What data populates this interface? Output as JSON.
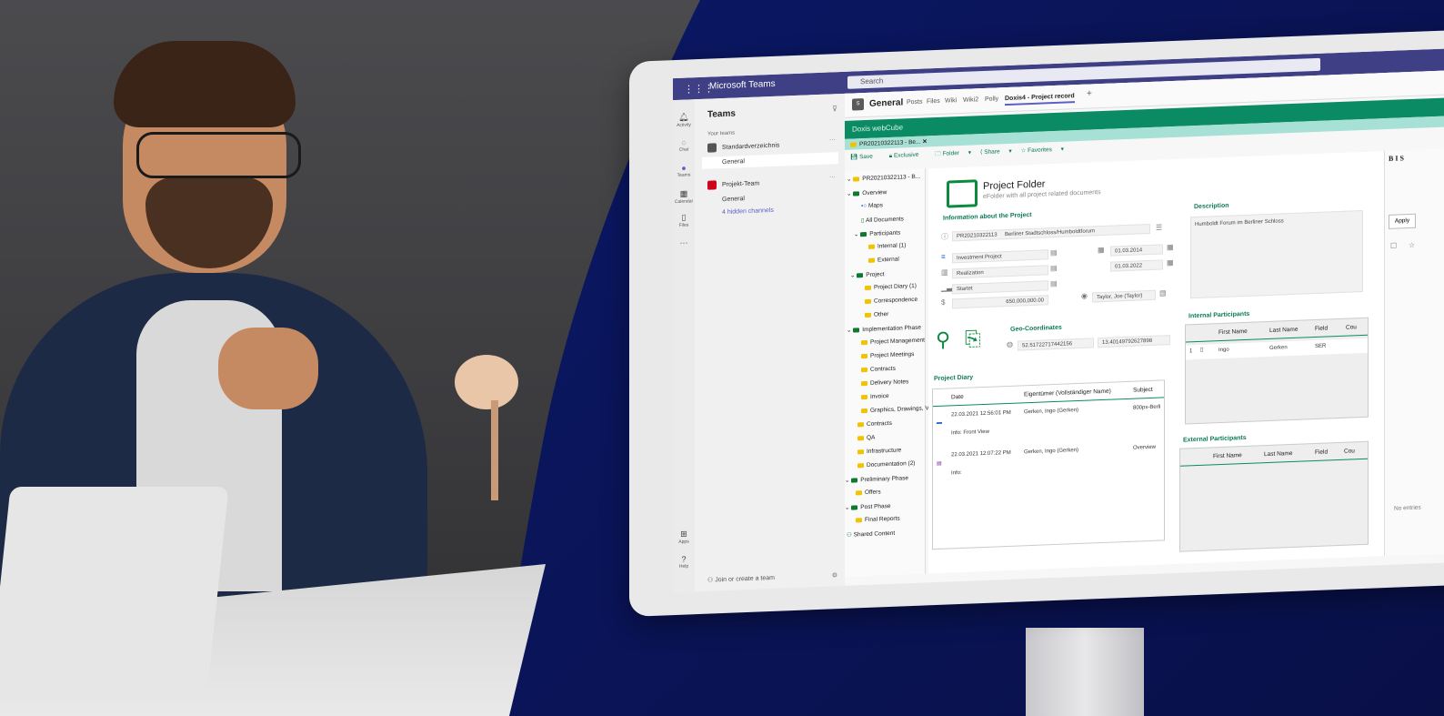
{
  "teams_app": {
    "title": "Microsoft Teams",
    "search_placeholder": "Search",
    "rail": [
      "Activity",
      "Chat",
      "Teams",
      "Calendar",
      "Files",
      "Apps",
      "Help"
    ],
    "teams_header": "Teams",
    "your_teams": "Your teams",
    "team1": "Standardverzeichnis",
    "team1_channel": "General",
    "team2": "Projekt-Team",
    "team2_channel": "General",
    "hidden_channels": "4 hidden channels",
    "join": "Join or create a team"
  },
  "channel": {
    "badge": "S",
    "title": "General",
    "tabs": [
      "Posts",
      "Files",
      "Wiki",
      "Wiki2",
      "Polly",
      "Doxis4 - Project record"
    ]
  },
  "webcube": {
    "brand": "Doxis webCube",
    "doc_tab": "PR20210322113 - Be...",
    "toolbar": [
      "Save",
      "Exclusive",
      "Folder",
      "Share",
      "Favorites"
    ]
  },
  "tree": [
    "PR20210322113 - B...",
    "Overview",
    "Maps",
    "All Documents",
    "Participants",
    "Internal (1)",
    "External",
    "Project",
    "Project Diary (1)",
    "Correspondence",
    "Other",
    "Implementation Phase",
    "Project Management",
    "Project Meetings",
    "Contracts",
    "Delivery Notes",
    "Invoice",
    "Graphics, Drawings, Vid",
    "Contracts",
    "QA",
    "Infrastructure",
    "Documentation (2)",
    "Preliminary Phase",
    "Offers",
    "Post Phase",
    "Final Reports",
    "Shared Content"
  ],
  "folder": {
    "title": "Project Folder",
    "subtitle": "eFolder with all project related documents",
    "info_header": "Information about the Project",
    "project_no": "PR20210322113",
    "project_name": "Berliner Stadtschloss/Humboldtforum",
    "type": "Investment Project",
    "phase": "Realization",
    "status": "Startet",
    "amount": "650,000,000.00",
    "date_start": "01.03.2014",
    "date_end": "01.03.2022",
    "owner": "Taylor, Joe (Taylor)",
    "geo_header": "Geo-Coordinates",
    "lat": "52.51722717442156",
    "lon": "13.40149792627898",
    "desc_header": "Description",
    "desc": "Humboldt Forum im Berliner Schloss"
  },
  "diary": {
    "header": "Project Diary",
    "cols": [
      "Date",
      "Eigentümer (Vollständiger Name)",
      "Subject"
    ],
    "rows": [
      {
        "date": "22.03.2021 12:56:01 PM",
        "owner": "Gerken, Ingo (Gerken)",
        "subject": "800px-Berli",
        "info": "Info: Front View"
      },
      {
        "date": "22.03.2021 12:07:22 PM",
        "owner": "Gerken, Ingo (Gerken)",
        "subject": "Overview",
        "info": "Info:"
      }
    ]
  },
  "internal": {
    "header": "Internal Participants",
    "cols": [
      "First Name",
      "Last Name",
      "Field",
      "Cou"
    ],
    "row": {
      "num": "1",
      "first": "Ingo",
      "last": "Gerken",
      "field": "SER"
    }
  },
  "external": {
    "header": "External Participants",
    "cols": [
      "First Name",
      "Last Name",
      "Field",
      "Cou"
    ]
  },
  "panel": {
    "format": "B I S",
    "apply": "Apply",
    "no_entries": "No entries"
  }
}
